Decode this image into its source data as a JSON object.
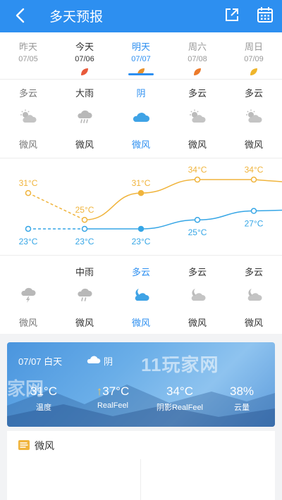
{
  "header": {
    "title": "多天预报",
    "back_icon": "back-arrow-icon",
    "share_icon": "share-icon",
    "calendar_icon": "calendar-icon",
    "bg_color": "#2d8ff0"
  },
  "days": [
    {
      "name": "昨天",
      "date": "07/05",
      "state": "past",
      "leaf_color": ""
    },
    {
      "name": "今天",
      "date": "07/06",
      "state": "today",
      "leaf_color": "#e8593a"
    },
    {
      "name": "明天",
      "date": "07/07",
      "state": "selected",
      "leaf_color": "#e8902a"
    },
    {
      "name": "周六",
      "date": "07/08",
      "state": "future",
      "leaf_color": "#ec7a2a"
    },
    {
      "name": "周日",
      "date": "07/09",
      "state": "future",
      "leaf_color": "#efb52a"
    }
  ],
  "day_forecast": [
    {
      "condition": "多云",
      "icon": "partly-cloudy-sun-icon",
      "wind": "微风"
    },
    {
      "condition": "大雨",
      "icon": "heavy-rain-icon",
      "wind": "微风"
    },
    {
      "condition": "阴",
      "icon": "overcast-cloud-icon",
      "wind": "微风"
    },
    {
      "condition": "多云",
      "icon": "partly-cloudy-sun-icon",
      "wind": "微风"
    },
    {
      "condition": "多云",
      "icon": "partly-cloudy-sun-icon",
      "wind": "微风"
    }
  ],
  "night_forecast": [
    {
      "condition": "",
      "icon": "thunder-rain-icon",
      "wind": "微风"
    },
    {
      "condition": "中雨",
      "icon": "moderate-rain-icon",
      "wind": "微风"
    },
    {
      "condition": "多云",
      "icon": "partly-cloudy-moon-icon",
      "wind": "微风"
    },
    {
      "condition": "多云",
      "icon": "partly-cloudy-moon-icon",
      "wind": "微风"
    },
    {
      "condition": "多云",
      "icon": "partly-cloudy-moon-icon",
      "wind": "微风"
    }
  ],
  "chart_data": {
    "type": "line",
    "categories": [
      "07/05",
      "07/06",
      "07/07",
      "07/08",
      "07/09"
    ],
    "series": [
      {
        "values": [
          31,
          25,
          31,
          34,
          34
        ],
        "color": "#f0b43c"
      },
      {
        "values": [
          23,
          23,
          23,
          25,
          27
        ],
        "color": "#36a6e6"
      }
    ],
    "labels": {
      "high": [
        "31°C",
        "25°C",
        "31°C",
        "34°C",
        "34°C"
      ],
      "low": [
        "23°C",
        "23°C",
        "23°C",
        "25°C",
        "27°C"
      ]
    },
    "ylim": [
      20,
      37
    ],
    "grid": false
  },
  "detail_card": {
    "date": "07/07 白天",
    "condition": "阴",
    "condition_icon": "cloud-icon",
    "stats": [
      {
        "value": "31°C",
        "label": "温度",
        "prefix": ""
      },
      {
        "value": "37°C",
        "label": "RealFeel",
        "prefix": "↑"
      },
      {
        "value": "34°C",
        "label": "阴影RealFeel",
        "prefix": ""
      },
      {
        "value": "38%",
        "label": "云量",
        "prefix": ""
      }
    ],
    "watermark": "11玩家网",
    "watermark2": "家网"
  },
  "wind_panel": {
    "label": "微风",
    "icon": "wind-icon"
  }
}
